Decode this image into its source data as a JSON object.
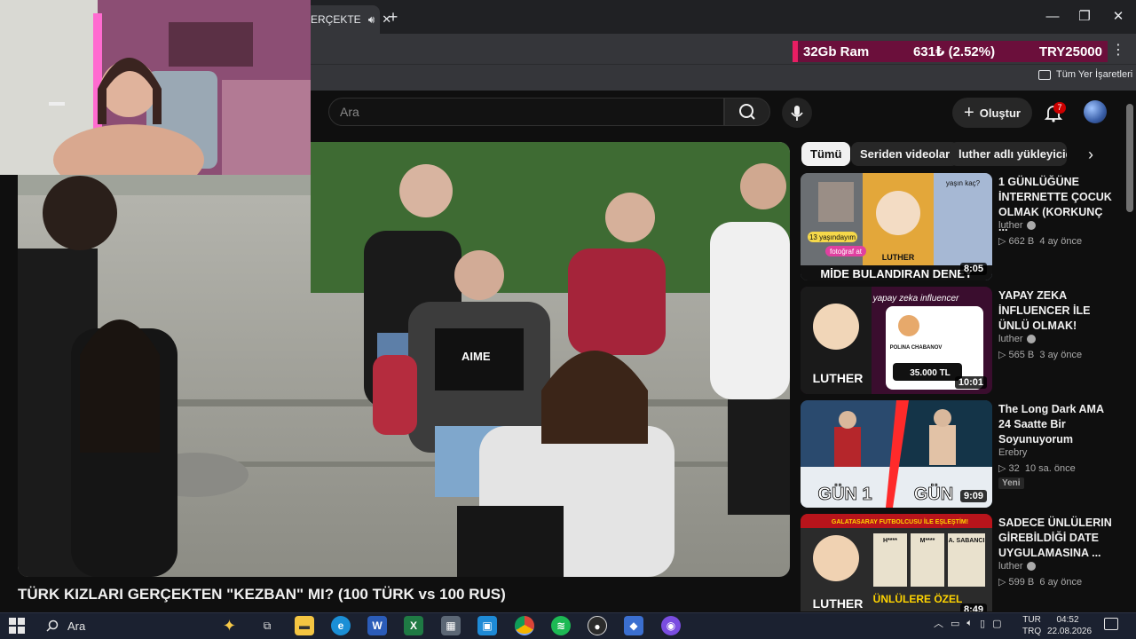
{
  "browser": {
    "tab_title": "ERÇEKTE",
    "new_tab_symbol": "+",
    "window_controls": [
      "—",
      "❐",
      "✕"
    ],
    "bookmarks_all": "Tüm Yer İşaretleri",
    "menu_symbol": "⋮"
  },
  "ticker": {
    "ram": "32Gb Ram",
    "value": "631₺ (2.52%)",
    "goal": "TRY25000"
  },
  "youtube": {
    "search_placeholder": "Ara",
    "create_label": "Oluştur",
    "notifications_count": "7"
  },
  "player": {
    "title": "TÜRK KIZLARI GERÇEKTEN \"KEZBAN\" MI? (100 TÜRK vs 100 RUS)",
    "shirt_text": "AIME"
  },
  "chips": [
    "Tümü",
    "Seriden videolar",
    "luther adlı yükleyiciden"
  ],
  "recommendations": [
    {
      "title": "1 GÜNLÜĞÜNE İNTERNETTE ÇOCUK OLMAK (KORKUNÇ ...",
      "channel": "luther",
      "verified": true,
      "views": "662 B",
      "age": "4 ay önce",
      "duration": "8:05",
      "thumb_caption": "MİDE BULANDIRAN DENEY",
      "thumb_tags": [
        "13 yaşındayım",
        "fotoğraf at",
        "LUTHER",
        "yaşın kaç?"
      ]
    },
    {
      "title": "YAPAY ZEKA İNFLUENCER İLE ÜNLÜ OLMAK!",
      "channel": "luther",
      "verified": true,
      "views": "565 B",
      "age": "3 ay önce",
      "duration": "10:01",
      "thumb_caption": "LUTHER",
      "thumb_tags": [
        "yapay zeka influencer",
        "POLINA CHABANOV",
        "35.000 TL"
      ]
    },
    {
      "title": "The Long Dark AMA 24 Saatte Bir Soyunuyorum",
      "channel": "Erebry",
      "verified": false,
      "views": "32",
      "age": "10 sa. önce",
      "duration": "9:09",
      "badge": "Yeni",
      "thumb_caption_left": "GÜN 1",
      "thumb_caption_right": "GÜN"
    },
    {
      "title": "SADECE ÜNLÜLERIN GİREBİLDİĞİ DATE UYGULAMASINA ...",
      "channel": "luther",
      "verified": true,
      "views": "599 B",
      "age": "6 ay önce",
      "duration": "8:49",
      "thumb_caption": "LUTHER",
      "thumb_tags": [
        "GALATASARAY FUTBOLCUSU İLE EŞLEŞTİM!",
        "H****",
        "M****",
        "A. SABANCI",
        "ÜNLÜLERE ÖZEL"
      ]
    }
  ],
  "taskbar": {
    "search_placeholder": "Ara",
    "lang_top": "TUR",
    "lang_bottom": "TRQ",
    "time": "04:52",
    "date": "22.08.2026"
  },
  "colors": {
    "ticker_bg": "#6b0f3b",
    "ticker_accent": "#e91e63",
    "yt_bg": "#0f0f0f",
    "chip_active": "#f1f1f1"
  }
}
